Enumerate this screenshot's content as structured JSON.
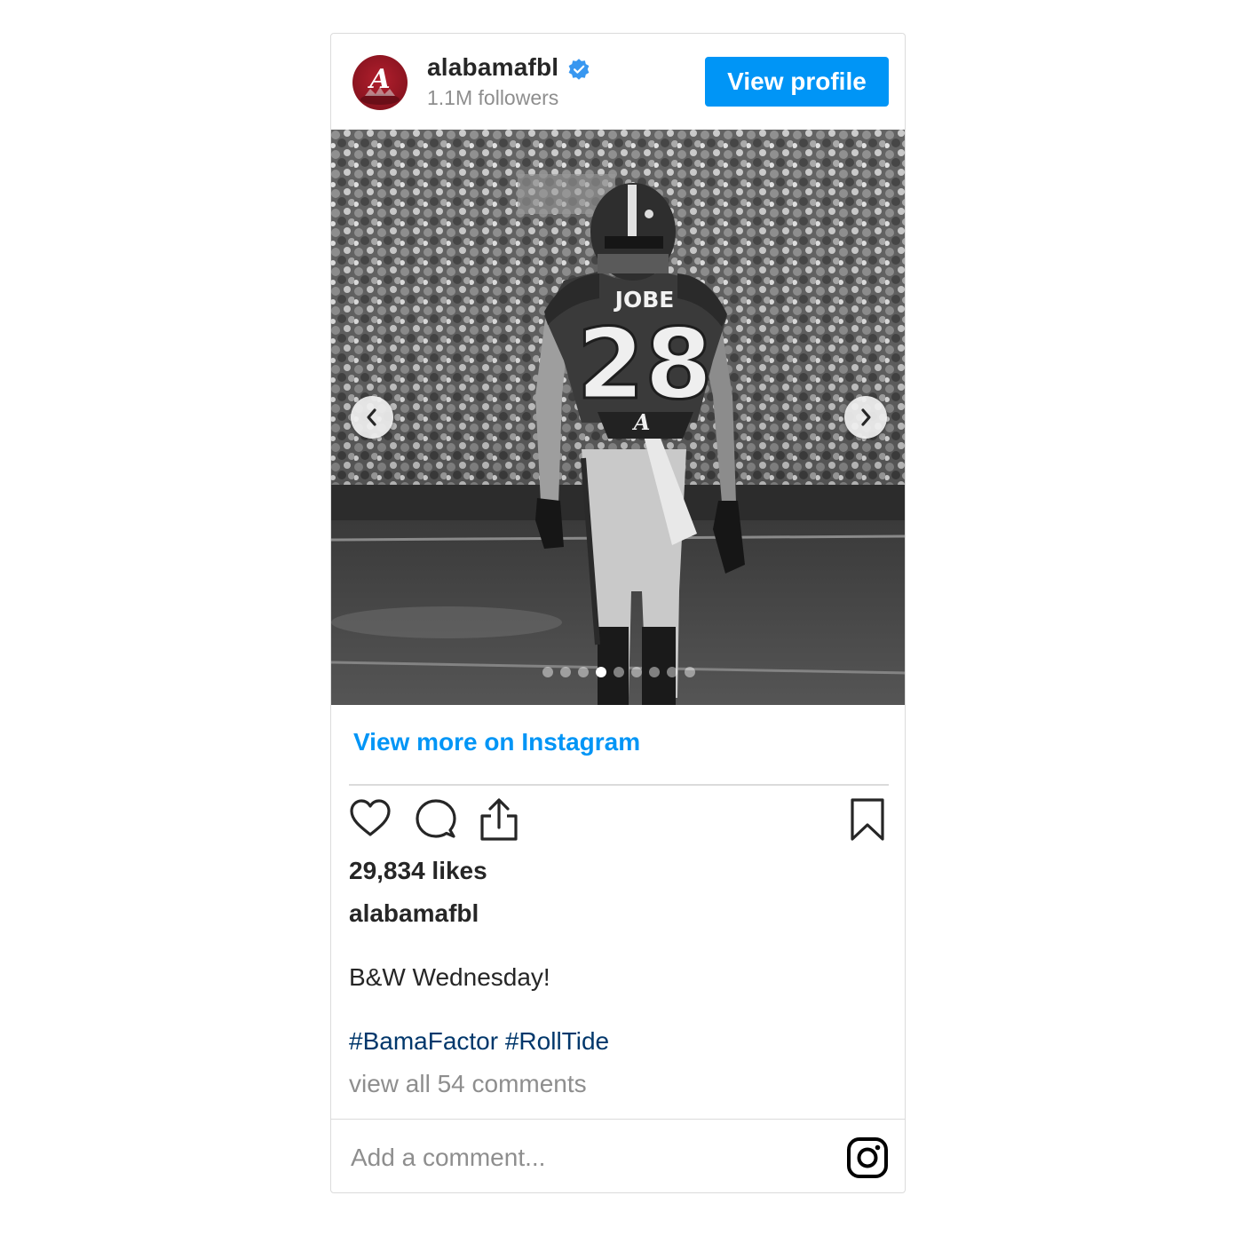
{
  "account": {
    "username": "alabamafbl",
    "followers": "1.1M followers",
    "verified": true,
    "view_profile_label": "View profile"
  },
  "post": {
    "image_alt": "Black and white photo of Alabama football player #28 JOBE walking on the field",
    "jersey_name": "JOBE",
    "jersey_number": "28",
    "carousel": {
      "total": 9,
      "active_index": 3
    }
  },
  "view_more_label": "View more on Instagram",
  "engagement": {
    "likes": "29,834 likes"
  },
  "caption": {
    "username": "alabamafbl",
    "text": "B&W Wednesday!",
    "hashtags": [
      "#BamaFactor",
      "#RollTide"
    ]
  },
  "comments_link": "view all 54 comments",
  "comment_input": {
    "placeholder": "Add a comment..."
  },
  "colors": {
    "accent_blue": "#0095f6",
    "hashtag_blue": "#00376b",
    "muted_gray": "#8e8e8e",
    "border_gray": "#dbdbdb",
    "crimson": "#9e1b32"
  },
  "icons": {
    "verified": "verified-badge-icon",
    "prev": "chevron-left-icon",
    "next": "chevron-right-icon",
    "like": "heart-icon",
    "comment": "comment-bubble-icon",
    "share": "share-icon",
    "save": "bookmark-icon",
    "brand": "instagram-logo-icon"
  }
}
